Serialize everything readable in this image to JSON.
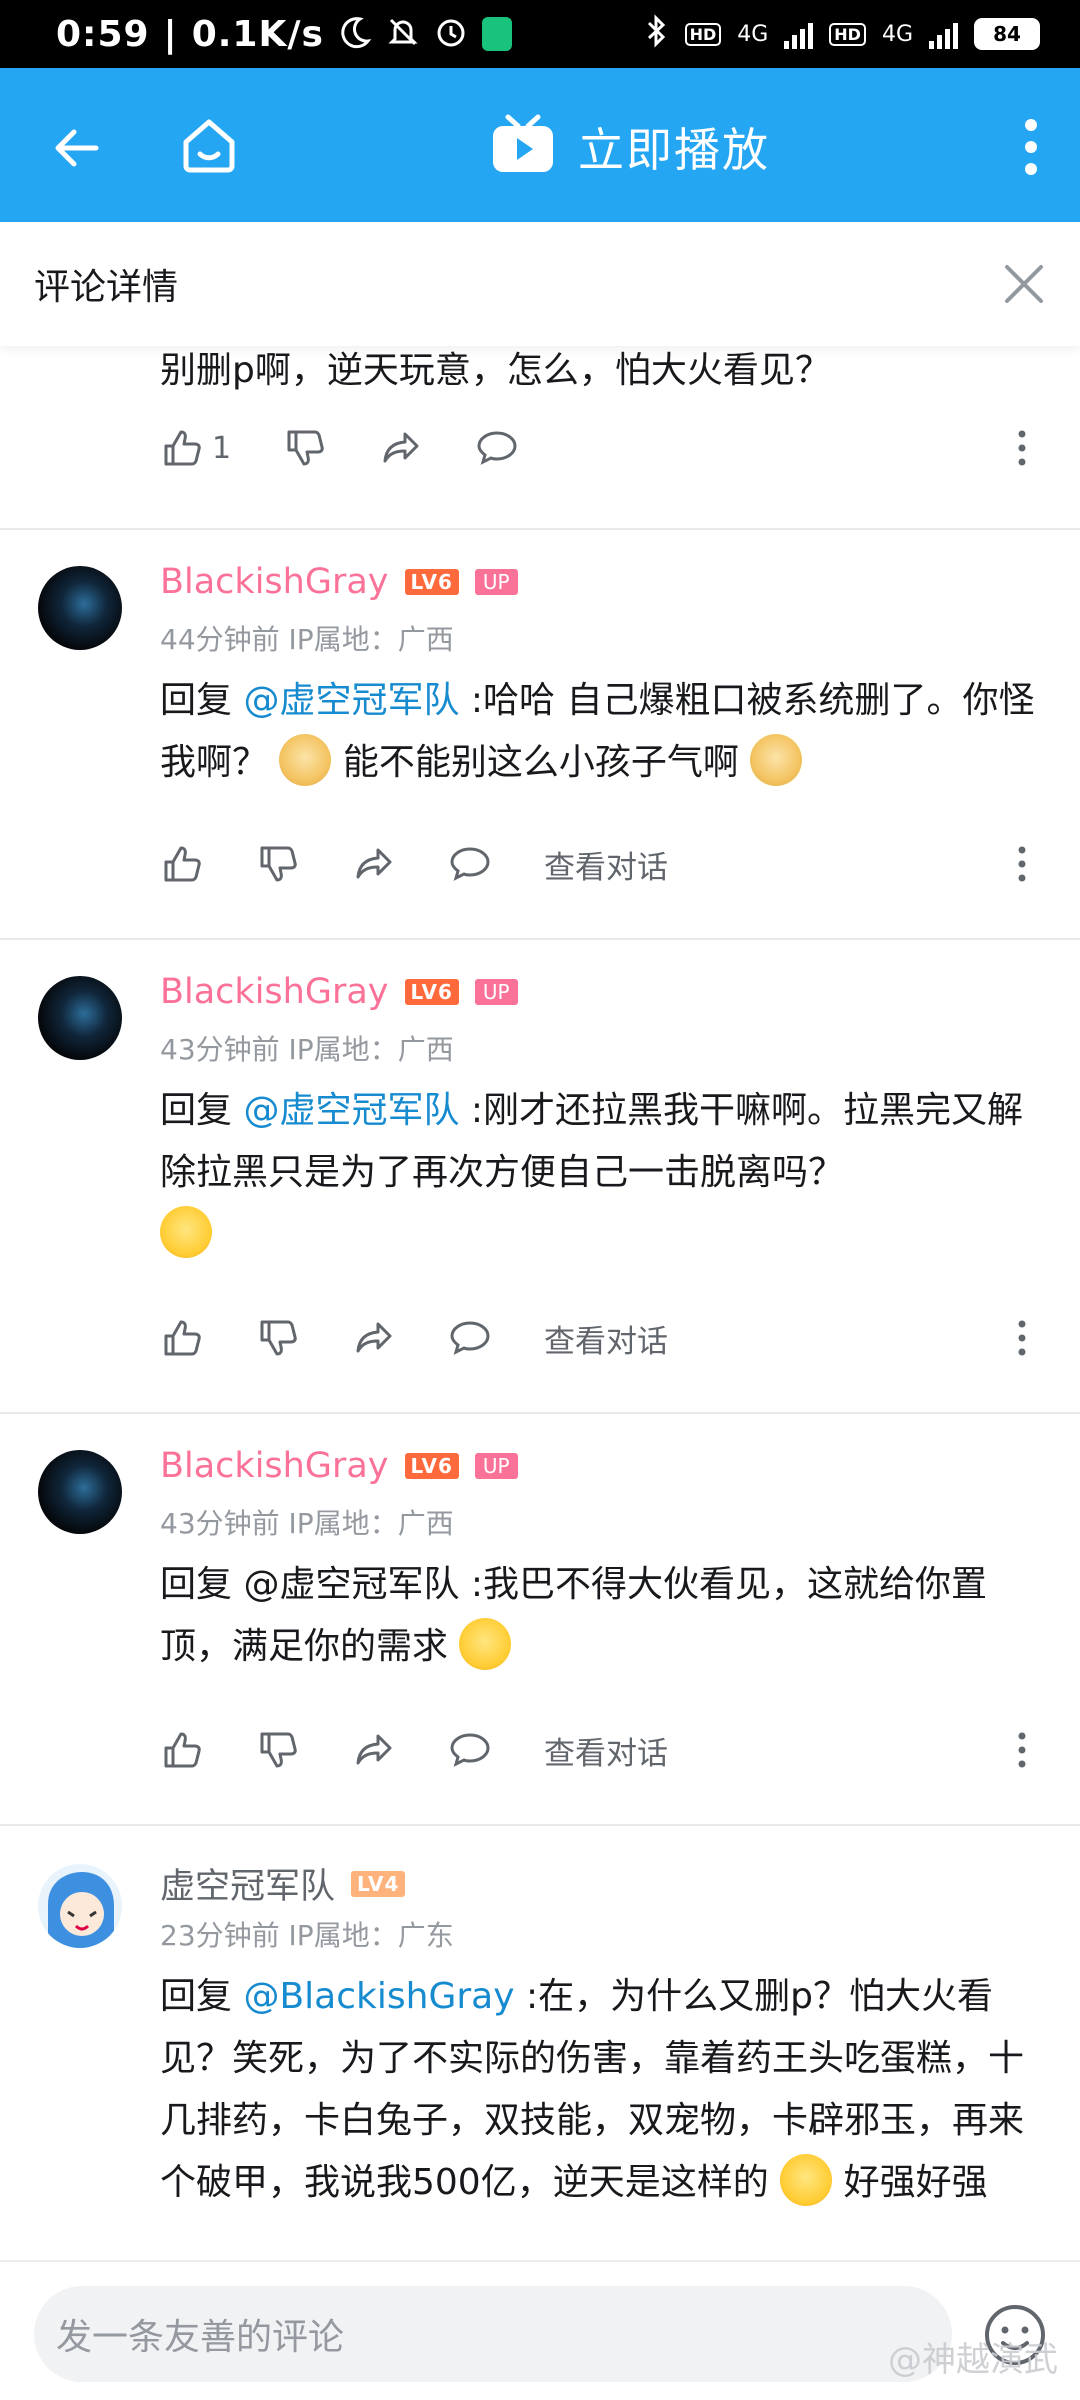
{
  "status_bar": {
    "time": "0:59",
    "network_speed": "0.1K/s",
    "hd1": "HD",
    "hd2": "HD",
    "net1": "4G",
    "net2": "4G",
    "battery": "84"
  },
  "header": {
    "title": "立即播放",
    "colors": {
      "header_bg": "#25a6f3",
      "username_pink": "#fb7299",
      "mention_blue": "#178bcf"
    }
  },
  "detail": {
    "title": "评论详情"
  },
  "comments": [
    {
      "text": "别删p啊，逆天玩意，怎么，怕大火看见？",
      "like_count": "1"
    },
    {
      "username": "BlackishGray",
      "level": "LV6",
      "up_badge": "UP",
      "time": "44分钟前",
      "ip": "IP属地：广西",
      "reply_prefix": "回复",
      "mention": "@虚空冠军队",
      "text_1": " :哈哈 自己爆粗口被系统删了。你怪我啊？",
      "text_2": "能不能别这么小孩子气啊",
      "view_dialog": "查看对话"
    },
    {
      "username": "BlackishGray",
      "level": "LV6",
      "up_badge": "UP",
      "time": "43分钟前",
      "ip": "IP属地：广西",
      "reply_prefix": "回复",
      "mention": "@虚空冠军队",
      "text_1": " :刚才还拉黑我干嘛啊。拉黑完又解除拉黑只是为了再次方便自己一击脱离吗？",
      "view_dialog": "查看对话"
    },
    {
      "username": "BlackishGray",
      "level": "LV6",
      "up_badge": "UP",
      "time": "43分钟前",
      "ip": "IP属地：广西",
      "text_1": "回复 @虚空冠军队 :我巴不得大伙看见，这就给你置顶，满足你的需求",
      "view_dialog": "查看对话"
    },
    {
      "username": "虚空冠军队",
      "level": "LV4",
      "time": "23分钟前",
      "ip": "IP属地：广东",
      "reply_prefix": "回复",
      "mention": "@BlackishGray",
      "text_1": " :在，为什么又删p？怕大火看见？笑死，为了不实际的伤害，靠着药王头吃蛋糕，十几排药，卡白兔子，双技能，双宠物，卡辟邪玉，再来个破甲，我说我500亿，逆天是这样的",
      "text_2": "好强好强"
    }
  ],
  "bottom": {
    "input_placeholder": "发一条友善的评论",
    "watermark": "@神越演武"
  },
  "icons": [
    "back-arrow-icon",
    "home-icon",
    "tv-play-icon",
    "more-vertical-icon",
    "close-icon",
    "thumb-up-icon",
    "thumb-down-icon",
    "share-icon",
    "comment-bubble-icon",
    "emoji-icon"
  ]
}
